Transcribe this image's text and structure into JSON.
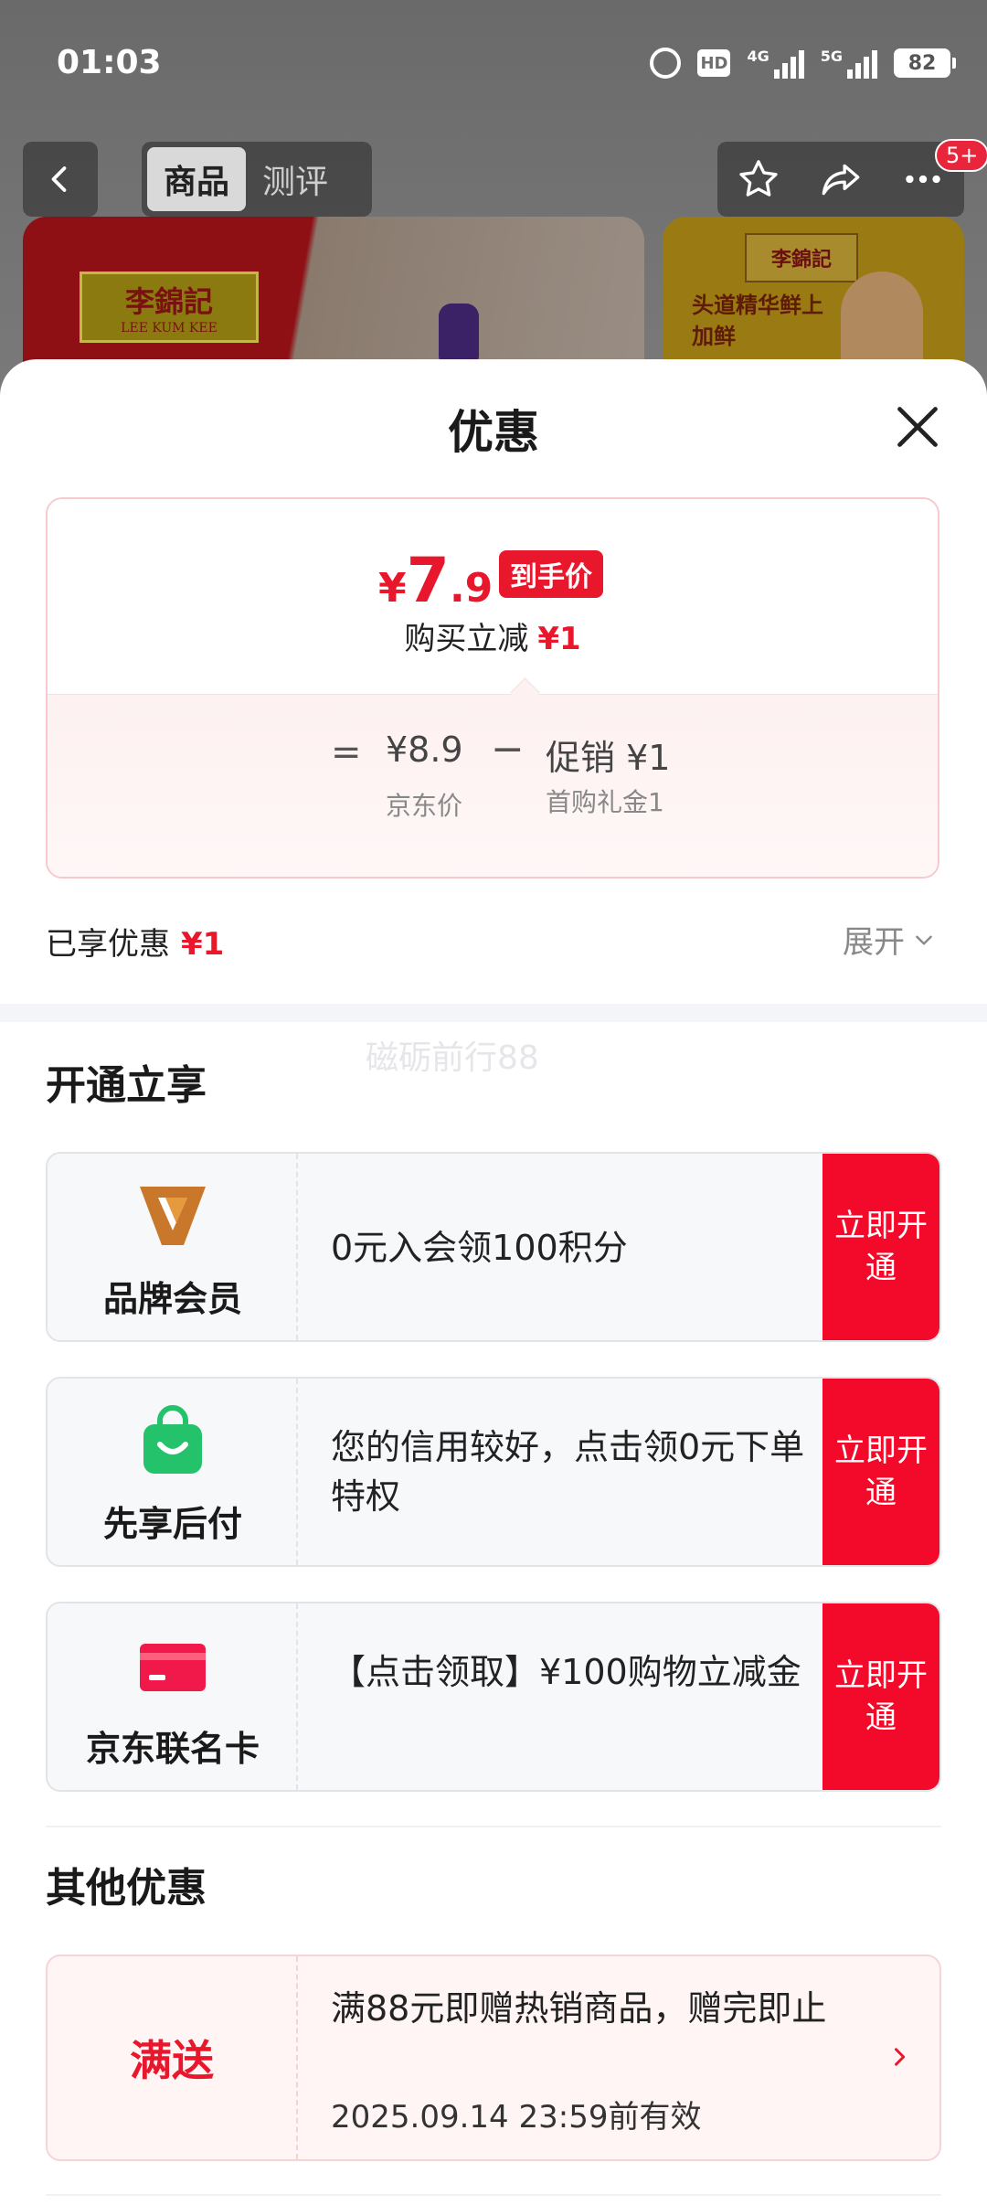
{
  "status_bar": {
    "time": "01:03",
    "hd_label": "HD",
    "net1_label": "4G",
    "net2_label": "5G",
    "battery": "82",
    "icons": [
      "alarm-icon",
      "hd-icon",
      "signal-4g-icon",
      "signal-5g-icon",
      "battery-icon"
    ]
  },
  "nav": {
    "tabs": [
      "商品",
      "测评"
    ],
    "active_tab": "商品",
    "badge": "5+"
  },
  "product_preview": {
    "brand_cn": "李錦記",
    "brand_en": "LEE KUM KEE",
    "side_promo": "头道精华鲜上加鲜"
  },
  "sheet": {
    "title": "优惠",
    "price": {
      "symbol": "¥",
      "int": "7",
      "dec": ".9",
      "tag": "到手价",
      "reduce_label": "购买立减",
      "reduce_amount": "¥1"
    },
    "breakdown": {
      "eq": "=",
      "jd_price": "¥8.9",
      "jd_label": "京东价",
      "minus": "−",
      "promo": "促销 ¥1",
      "promo_label": "首购礼金1"
    },
    "enjoyed_label": "已享优惠",
    "enjoyed_amount": "¥1",
    "expand_label": "展开",
    "watermark": "磁砺前行88",
    "open_section_title": "开通立享",
    "benefits": [
      {
        "name": "品牌会员",
        "desc": "0元入会领100积分",
        "button": "立即开通"
      },
      {
        "name": "先享后付",
        "desc": "您的信用较好，点击领0元下单特权",
        "button": "立即开通"
      },
      {
        "name": "京东联名卡",
        "desc": "【点击领取】¥100购物立减金",
        "button": "立即开通"
      }
    ],
    "other_section_title": "其他优惠",
    "other": {
      "tag": "满送",
      "desc": "满88元即赠热销商品，赠完即止",
      "valid": "2025.09.14 23:59前有效"
    }
  },
  "colors": {
    "accent_red": "#e8172c",
    "button_red": "#f30a2a",
    "jd_member_orange": "#c9782b",
    "paylater_green": "#23c26b",
    "card_pink": "#f0194a"
  }
}
